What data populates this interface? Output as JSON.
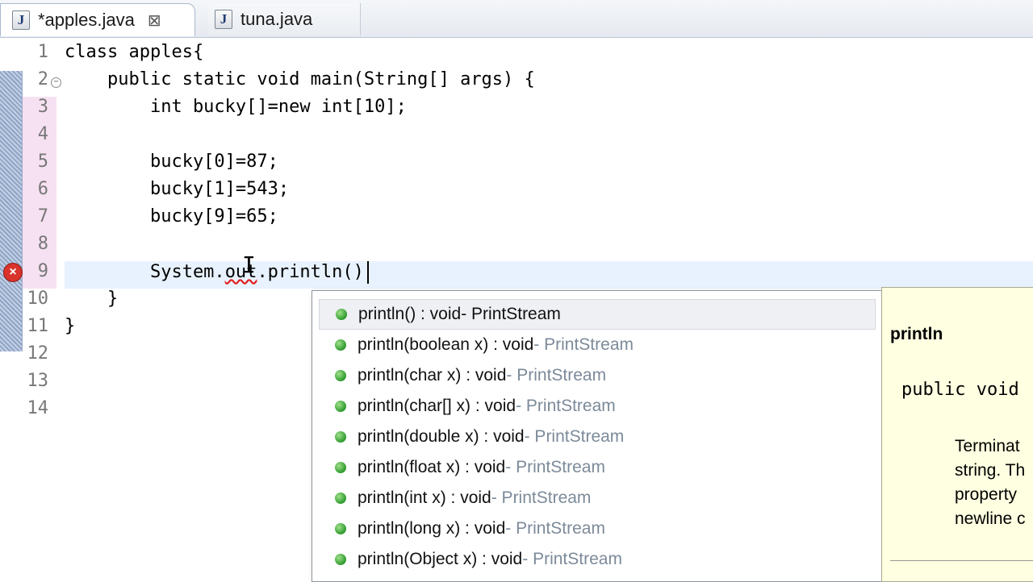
{
  "tabs": [
    {
      "label": "*apples.java",
      "icon": "java-file-icon",
      "close": "⊠"
    },
    {
      "label": "tuna.java",
      "icon": "java-file-icon"
    }
  ],
  "editor": {
    "line_numbers": [
      "1",
      "2",
      "3",
      "4",
      "5",
      "6",
      "7",
      "8",
      "9",
      "10",
      "11",
      "12",
      "13",
      "14"
    ],
    "lines": [
      "class apples{",
      "    public static void main(String[] args) {",
      "        int bucky[]=new int[10];",
      "",
      "        bucky[0]=87;",
      "        bucky[1]=543;",
      "        bucky[9]=65;",
      "",
      "        System.",
      "    }",
      "}",
      "",
      "",
      ""
    ],
    "line9_out": "out",
    "line9_rest": ".println()",
    "error_marker": "×"
  },
  "assist": {
    "proposals": [
      {
        "sig": "println() : void",
        "owner": " - PrintStream"
      },
      {
        "sig": "println(boolean x) : void",
        "owner": " - PrintStream"
      },
      {
        "sig": "println(char x) : void",
        "owner": " - PrintStream"
      },
      {
        "sig": "println(char[] x) : void",
        "owner": " - PrintStream"
      },
      {
        "sig": "println(double x) : void",
        "owner": " - PrintStream"
      },
      {
        "sig": "println(float x) : void",
        "owner": " - PrintStream"
      },
      {
        "sig": "println(int x) : void",
        "owner": " - PrintStream"
      },
      {
        "sig": "println(long x) : void",
        "owner": " - PrintStream"
      },
      {
        "sig": "println(Object x) : void",
        "owner": " - PrintStream"
      }
    ]
  },
  "javadoc": {
    "title": "println",
    "signature": "public void",
    "text": "Terminat\nstring. Th\nproperty\nnewline c"
  },
  "colors": {
    "error": "#d9342b",
    "current_line": "#e8f2fe",
    "doc_bg": "#ffffe1"
  }
}
